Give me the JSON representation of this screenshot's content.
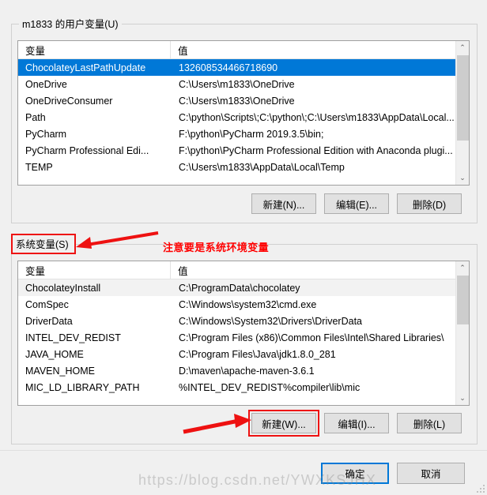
{
  "dialog": {
    "user_group_title": "m1833 的用户变量(U)",
    "system_group_title": "系统变量(S)",
    "ok_label": "确定",
    "cancel_label": "取消"
  },
  "columns": {
    "name": "变量",
    "value": "值"
  },
  "user_variables": {
    "rows": [
      {
        "name": "ChocolateyLastPathUpdate",
        "value": "132608534466718690",
        "selected": true
      },
      {
        "name": "OneDrive",
        "value": "C:\\Users\\m1833\\OneDrive",
        "selected": false
      },
      {
        "name": "OneDriveConsumer",
        "value": "C:\\Users\\m1833\\OneDrive",
        "selected": false
      },
      {
        "name": "Path",
        "value": "C:\\python\\Scripts\\;C:\\python\\;C:\\Users\\m1833\\AppData\\Local...",
        "selected": false
      },
      {
        "name": "PyCharm",
        "value": "F:\\python\\PyCharm 2019.3.5\\bin;",
        "selected": false
      },
      {
        "name": "PyCharm Professional Edi...",
        "value": "F:\\python\\PyCharm Professional Edition with Anaconda plugi...",
        "selected": false
      },
      {
        "name": "TEMP",
        "value": "C:\\Users\\m1833\\AppData\\Local\\Temp",
        "selected": false
      }
    ],
    "buttons": {
      "new": "新建(N)...",
      "edit": "编辑(E)...",
      "delete": "删除(D)"
    }
  },
  "system_variables": {
    "rows": [
      {
        "name": "ChocolateyInstall",
        "value": "C:\\ProgramData\\chocolatey",
        "hover": true
      },
      {
        "name": "ComSpec",
        "value": "C:\\Windows\\system32\\cmd.exe",
        "hover": false
      },
      {
        "name": "DriverData",
        "value": "C:\\Windows\\System32\\Drivers\\DriverData",
        "hover": false
      },
      {
        "name": "INTEL_DEV_REDIST",
        "value": "C:\\Program Files (x86)\\Common Files\\Intel\\Shared Libraries\\",
        "hover": false
      },
      {
        "name": "JAVA_HOME",
        "value": "C:\\Program Files\\Java\\jdk1.8.0_281",
        "hover": false
      },
      {
        "name": "MAVEN_HOME",
        "value": "D:\\maven\\apache-maven-3.6.1",
        "hover": false
      },
      {
        "name": "MIC_LD_LIBRARY_PATH",
        "value": "%INTEL_DEV_REDIST%compiler\\lib\\mic",
        "hover": false
      }
    ],
    "buttons": {
      "new": "新建(W)...",
      "edit": "编辑(I)...",
      "delete": "删除(L)"
    }
  },
  "annotations": {
    "note_text": "注意要是系统环境变量",
    "color": "#ff0000"
  },
  "scrollbars": {
    "up_glyph": "⌃",
    "down_glyph": "⌄"
  },
  "watermark": "https://blog.csdn.net/YWXKSJHX"
}
